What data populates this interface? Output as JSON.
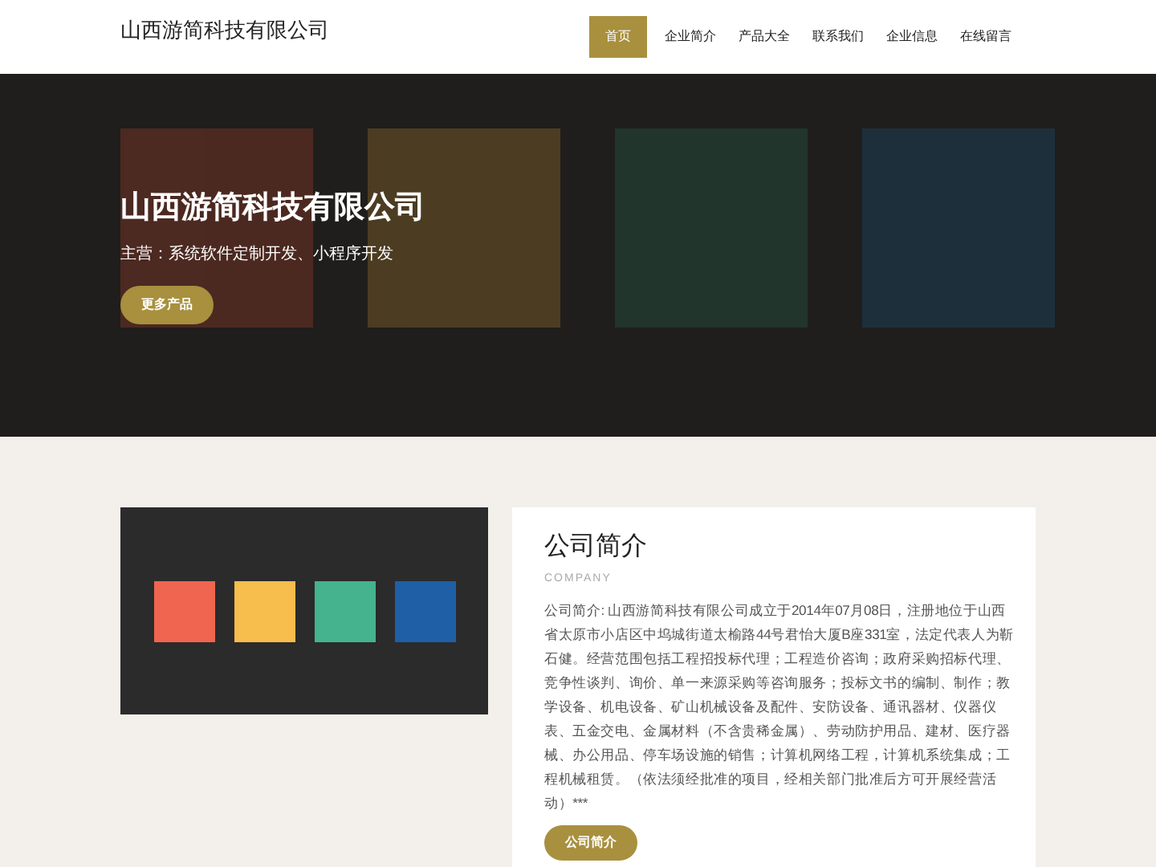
{
  "header": {
    "logo": "山西游简科技有限公司",
    "nav": [
      {
        "label": "首页",
        "selected": true
      },
      {
        "label": "企业简介",
        "selected": false
      },
      {
        "label": "产品大全",
        "selected": false
      },
      {
        "label": "联系我们",
        "selected": false
      },
      {
        "label": "企业信息",
        "selected": false
      },
      {
        "label": "在线留言",
        "selected": false
      }
    ]
  },
  "hero": {
    "title": "山西游简科技有限公司",
    "subtitle": "主营：系统软件定制开发、小程序开发",
    "button": "更多产品"
  },
  "about": {
    "title": "公司简介",
    "subtitle": "COMPANY",
    "text": "公司简介: 山西游简科技有限公司成立于2014年07月08日，注册地位于山西省太原市小店区中坞城街道太榆路44号君怡大厦B座331室，法定代表人为靳石健。经营范围包括工程招投标代理；工程造价咨询；政府采购招标代理、竞争性谈判、询价、单一来源采购等咨询服务；投标文书的编制、制作；教学设备、机电设备、矿山机械设备及配件、安防设备、通讯器材、仪器仪表、五金交电、金属材料（不含贵稀金属）、劳动防护用品、建材、医疗器械、办公用品、停车场设施的销售；计算机网络工程，计算机系统集成；工程机械租赁。（依法须经批准的项目，经相关部门批准后方可开展经营活动）***",
    "button": "公司简介"
  }
}
